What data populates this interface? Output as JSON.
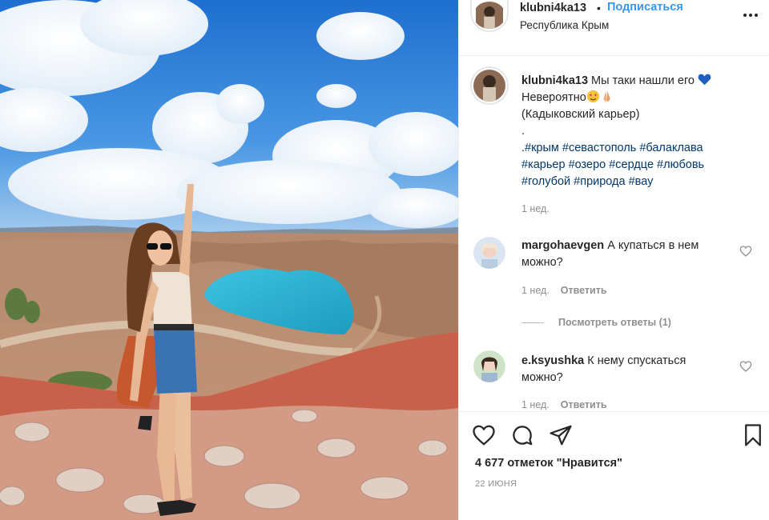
{
  "post": {
    "photo_icon": "photo",
    "username": "klubni4ka13",
    "dot": "•",
    "follow_label": "Подписаться",
    "location": "Республика Крым",
    "more_icon": "more-icon"
  },
  "caption": {
    "username": "klubni4ka13",
    "line1": "Мы таки нашли его",
    "line2": "Невероятно",
    "line3": "(Кадыковский карьер)",
    "line4": ".",
    "hashtags_line1": ".#крым #севастополь #балаклава",
    "hashtags_line2": "#карьер #озеро #сердце #любовь",
    "hashtags_line3": "#голубой #природа #вау",
    "time": "1 нед."
  },
  "comments": [
    {
      "username": "margohaevgen",
      "text": "А купаться в нем можно?",
      "time": "1 нед.",
      "reply_label": "Ответить"
    },
    {
      "username": "e.ksyushka",
      "text": "К нему спускаться можно?",
      "time": "1 нед.",
      "reply_label": "Ответить"
    }
  ],
  "view_replies": "Посмотреть ответы (1)",
  "actions": {
    "likes": "4 677 отметок \"Нравится\"",
    "date": "22 ИЮНЯ"
  },
  "colors": {
    "link_blue": "#3897f0",
    "hashtag": "#00376b",
    "muted": "#8e8e8e",
    "lake": "#2aa6c8"
  }
}
